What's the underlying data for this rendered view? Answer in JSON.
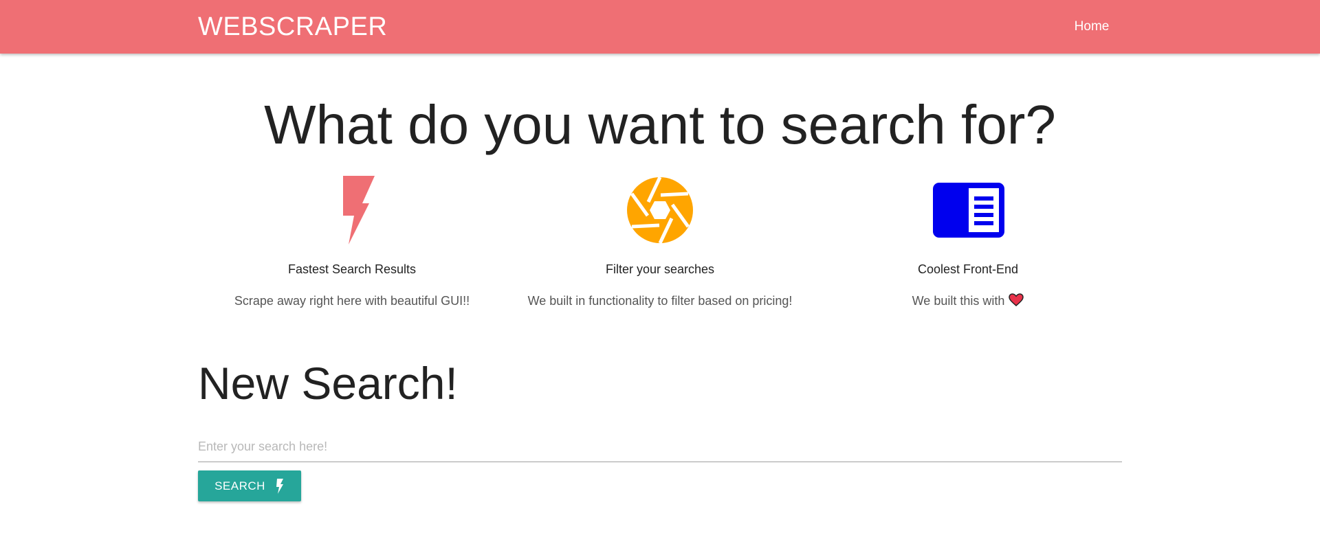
{
  "navbar": {
    "brand": "WEBSCRAPER",
    "links": [
      {
        "label": "Home"
      }
    ],
    "background": "#ef6f74"
  },
  "hero": {
    "title": "What do you want to search for?"
  },
  "features": [
    {
      "icon": "lightning-bolt-icon",
      "title": "Fastest Search Results",
      "description": "Scrape away right here with beautiful GUI!!",
      "color": "#ef6f74"
    },
    {
      "icon": "camera-aperture-icon",
      "title": "Filter your searches",
      "description": "We built in functionality to filter based on pricing!",
      "color": "#ffa500"
    },
    {
      "icon": "document-panel-icon",
      "title": "Coolest Front-End",
      "description": "We built this with",
      "color": "#0000ee",
      "trailing_icon": "heart-icon"
    }
  ],
  "search": {
    "title": "New Search!",
    "input_value": "",
    "placeholder": "Enter your search here!",
    "button_label": "SEARCH",
    "button_icon": "lightning-bolt-icon",
    "button_color": "#26a69a"
  }
}
